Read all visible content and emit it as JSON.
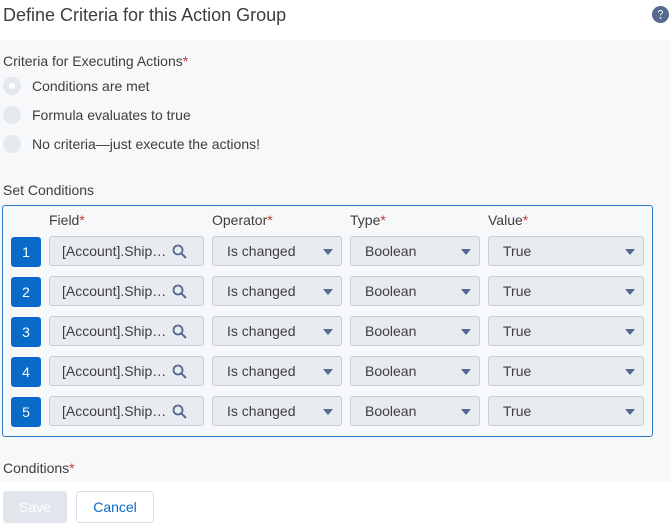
{
  "dialog": {
    "title": "Define Criteria for this Action Group",
    "help_icon": "question-circle-icon"
  },
  "criteria": {
    "label": "Criteria for Executing Actions",
    "required_mark": "*",
    "options": [
      {
        "label": "Conditions are met",
        "selected": true
      },
      {
        "label": "Formula evaluates to true",
        "selected": false
      },
      {
        "label": "No criteria—just execute the actions!",
        "selected": false
      }
    ]
  },
  "set_conditions": {
    "label": "Set Conditions",
    "columns": {
      "field": "Field",
      "operator": "Operator",
      "type": "Type",
      "value": "Value",
      "required_mark": "*"
    },
    "rows": [
      {
        "num": "1",
        "field": "[Account].Ship…",
        "operator": "Is changed",
        "type": "Boolean",
        "value": "True"
      },
      {
        "num": "2",
        "field": "[Account].Ship…",
        "operator": "Is changed",
        "type": "Boolean",
        "value": "True"
      },
      {
        "num": "3",
        "field": "[Account].Ship…",
        "operator": "Is changed",
        "type": "Boolean",
        "value": "True"
      },
      {
        "num": "4",
        "field": "[Account].Ship…",
        "operator": "Is changed",
        "type": "Boolean",
        "value": "True"
      },
      {
        "num": "5",
        "field": "[Account].Ship…",
        "operator": "Is changed",
        "type": "Boolean",
        "value": "True"
      }
    ]
  },
  "conditions": {
    "label": "Conditions",
    "required_mark": "*"
  },
  "footer": {
    "save_label": "Save",
    "cancel_label": "Cancel"
  },
  "colors": {
    "accent": "#0a6bc6",
    "border_active": "#2c78c5",
    "required": "#c23934",
    "text": "#3e3e3c"
  }
}
